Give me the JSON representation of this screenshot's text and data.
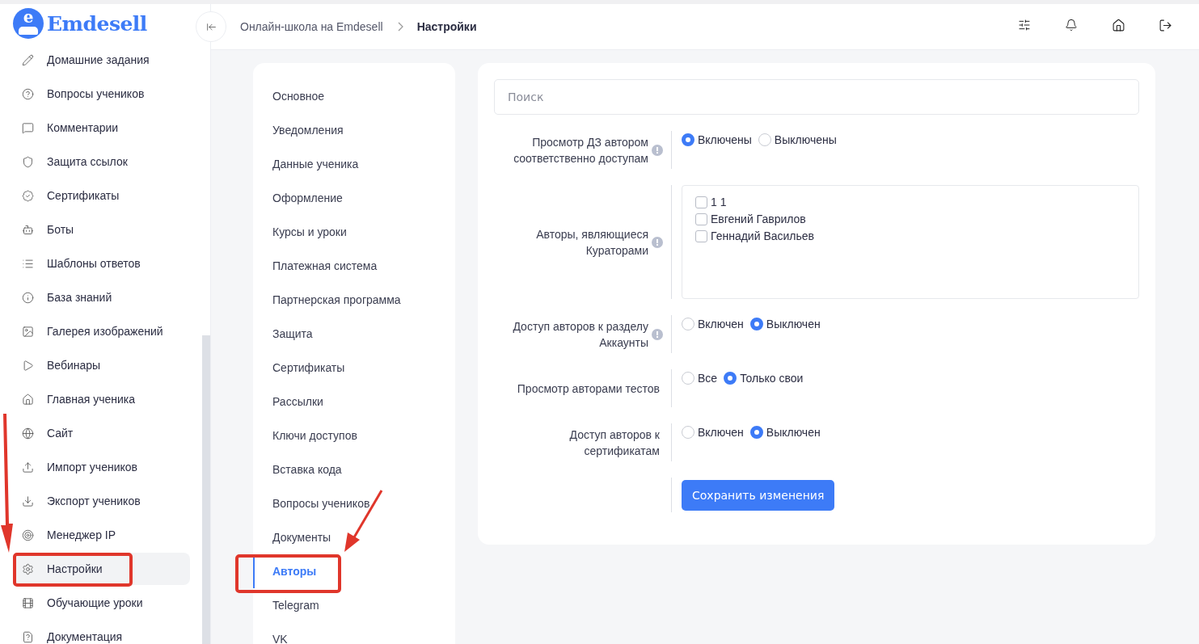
{
  "sidebar": {
    "logo_mark": "e",
    "logo_text": "Emdesell",
    "items": [
      {
        "label": "Домашние задания",
        "selected": false
      },
      {
        "label": "Вопросы учеников",
        "selected": false
      },
      {
        "label": "Комментарии",
        "selected": false
      },
      {
        "label": "Защита ссылок",
        "selected": false
      },
      {
        "label": "Сертификаты",
        "selected": false
      },
      {
        "label": "Боты",
        "selected": false
      },
      {
        "label": "Шаблоны ответов",
        "selected": false
      },
      {
        "label": "База знаний",
        "selected": false
      },
      {
        "label": "Галерея изображений",
        "selected": false
      },
      {
        "label": "Вебинары",
        "selected": false
      },
      {
        "label": "Главная ученика",
        "selected": false
      },
      {
        "label": "Сайт",
        "selected": false
      },
      {
        "label": "Импорт учеников",
        "selected": false
      },
      {
        "label": "Экспорт учеников",
        "selected": false
      },
      {
        "label": "Менеджер IP",
        "selected": false
      },
      {
        "label": "Настройки",
        "selected": true
      },
      {
        "label": "Обучающие уроки",
        "selected": false
      },
      {
        "label": "Документация",
        "selected": false
      }
    ]
  },
  "breadcrumbs": [
    {
      "label": "Онлайн-школа на Emdesell",
      "current": false
    },
    {
      "label": "Настройки",
      "current": true
    }
  ],
  "settings_menu": [
    {
      "label": "Основное",
      "selected": false
    },
    {
      "label": "Уведомления",
      "selected": false
    },
    {
      "label": "Данные ученика",
      "selected": false
    },
    {
      "label": "Оформление",
      "selected": false
    },
    {
      "label": "Курсы и уроки",
      "selected": false
    },
    {
      "label": "Платежная система",
      "selected": false
    },
    {
      "label": "Партнерская программа",
      "selected": false
    },
    {
      "label": "Защита",
      "selected": false
    },
    {
      "label": "Сертификаты",
      "selected": false
    },
    {
      "label": "Рассылки",
      "selected": false
    },
    {
      "label": "Ключи доступов",
      "selected": false
    },
    {
      "label": "Вставка кода",
      "selected": false
    },
    {
      "label": "Вопросы учеников",
      "selected": false
    },
    {
      "label": "Документы",
      "selected": false
    },
    {
      "label": "Авторы",
      "selected": true
    },
    {
      "label": "Telegram",
      "selected": false
    },
    {
      "label": "VK",
      "selected": false
    }
  ],
  "form": {
    "search": {
      "placeholder": "Поиск"
    },
    "rows": [
      {
        "kind": "radio",
        "label": "Просмотр ДЗ автором соответственно доступам",
        "info": true,
        "options": [
          {
            "label": "Включены",
            "selected": true
          },
          {
            "label": "Выключены",
            "selected": false
          }
        ]
      },
      {
        "kind": "checklist",
        "label": "Авторы, являющиеся Кураторами",
        "info": true,
        "options": [
          {
            "label": "1 1",
            "checked": false
          },
          {
            "label": "Евгений Гаврилов",
            "checked": false
          },
          {
            "label": "Геннадий Васильев",
            "checked": false
          }
        ]
      },
      {
        "kind": "radio",
        "label": "Доступ авторов к разделу Аккаунты",
        "info": true,
        "options": [
          {
            "label": "Включен",
            "selected": false
          },
          {
            "label": "Выключен",
            "selected": true
          }
        ]
      },
      {
        "kind": "radio",
        "label": "Просмотр авторами тестов",
        "info": false,
        "options": [
          {
            "label": "Все",
            "selected": false
          },
          {
            "label": "Только свои",
            "selected": true
          }
        ]
      },
      {
        "kind": "radio",
        "label": "Доступ авторов к сертификатам",
        "info": false,
        "options": [
          {
            "label": "Включен",
            "selected": false
          },
          {
            "label": "Выключен",
            "selected": true
          }
        ]
      }
    ],
    "save_button": "Сохранить изменения"
  }
}
